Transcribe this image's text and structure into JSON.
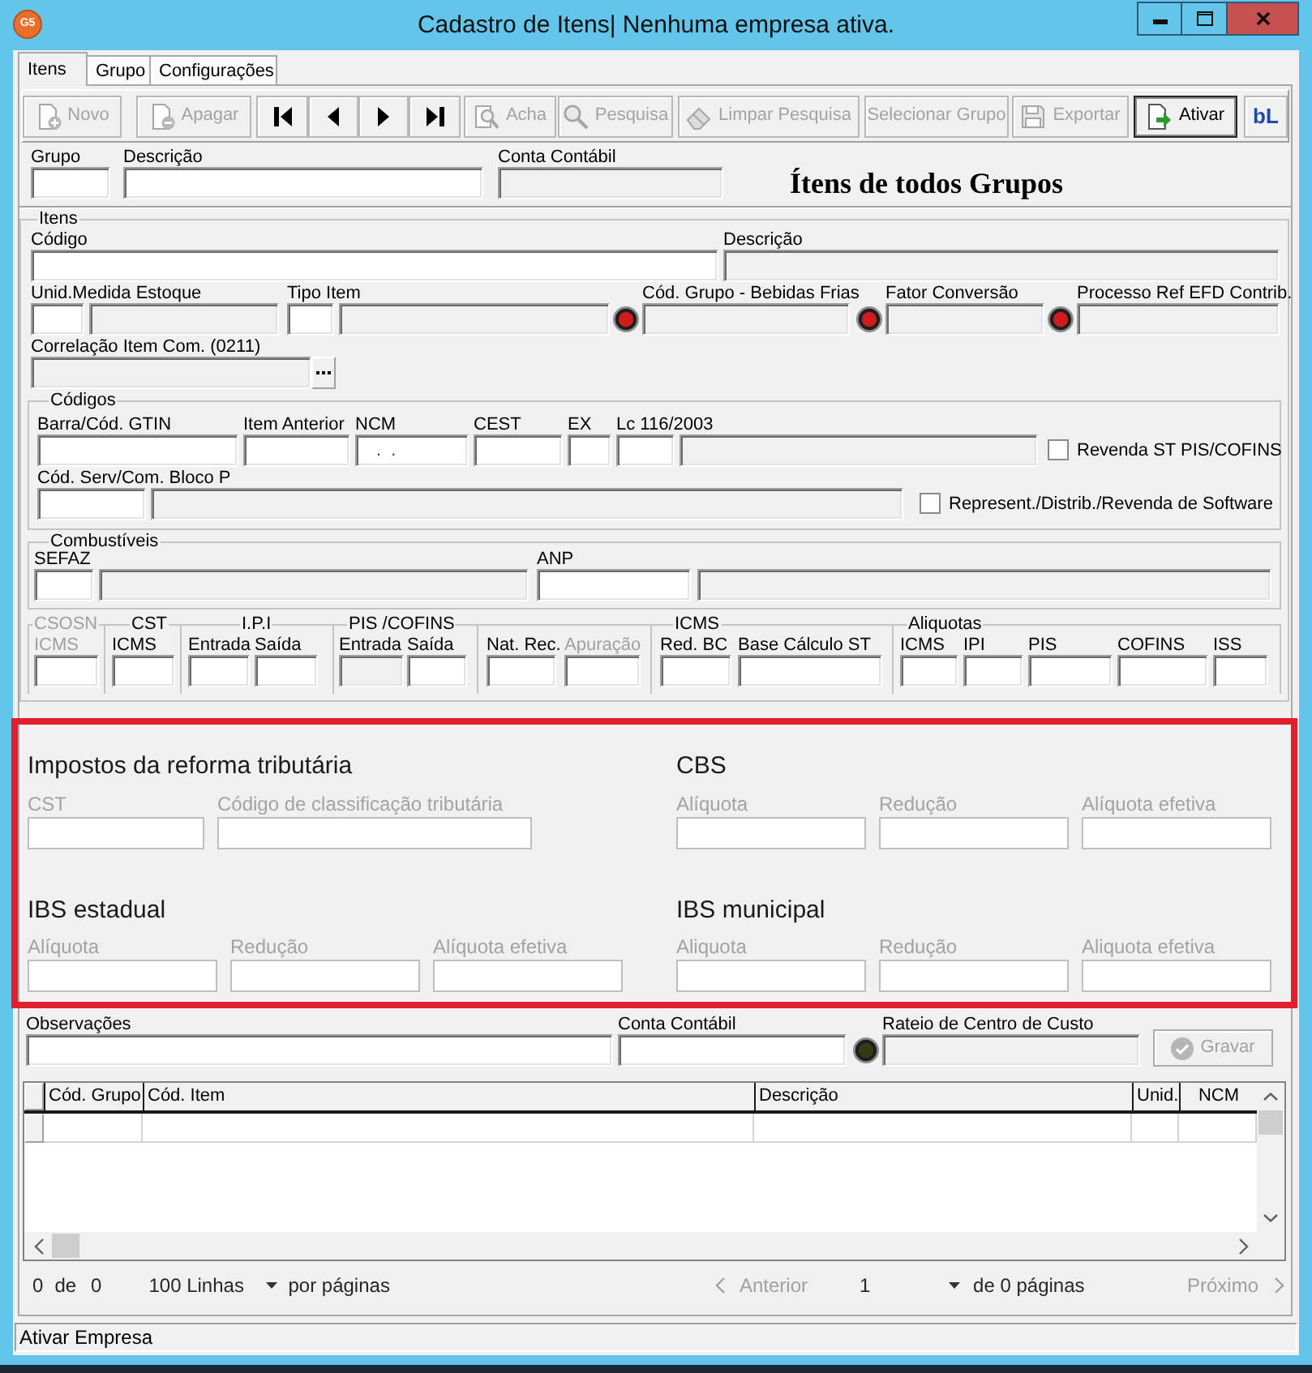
{
  "window": {
    "logo": "G5",
    "title": "Cadastro de Itens| Nenhuma empresa ativa."
  },
  "tabs": [
    {
      "label": "Itens",
      "selected": true
    },
    {
      "label": "Grupo",
      "selected": false
    },
    {
      "label": "Configurações",
      "selected": false
    }
  ],
  "toolbar": [
    {
      "kind": "new",
      "label": "Novo",
      "disabled": true,
      "focused": false
    },
    {
      "kind": "delete",
      "label": "Apagar",
      "disabled": true,
      "focused": false
    },
    {
      "kind": "first",
      "disabled": false,
      "focused": false
    },
    {
      "kind": "previous",
      "disabled": false,
      "focused": false
    },
    {
      "kind": "next",
      "disabled": false,
      "focused": false
    },
    {
      "kind": "last",
      "disabled": false,
      "focused": false
    },
    {
      "kind": "find",
      "label": "Acha",
      "disabled": true,
      "focused": false
    },
    {
      "kind": "search",
      "label": "Pesquisa",
      "disabled": true,
      "focused": false
    },
    {
      "kind": "clear",
      "label": "Limpar Pesquisa",
      "disabled": true,
      "focused": false
    },
    {
      "kind": "plain",
      "label": "Selecionar Grupo",
      "disabled": true,
      "focused": false
    },
    {
      "kind": "export",
      "label": "Exportar",
      "disabled": true,
      "focused": false
    },
    {
      "kind": "activate",
      "label": "Ativar",
      "disabled": false,
      "focused": true
    },
    {
      "kind": "logo",
      "label": "bL",
      "disabled": false,
      "focused": false
    }
  ],
  "filter": {
    "fields": [
      {
        "label": "Grupo",
        "disabled": false
      },
      {
        "label": "Descrição",
        "disabled": false
      },
      {
        "label": "Conta Contábil",
        "disabled": true
      }
    ],
    "heading": "Ítens de todos Grupos"
  },
  "itens": {
    "title": "Itens",
    "rows": [
      {
        "fields": [
          {
            "kind": "plain",
            "label": "Código",
            "boxes": [
              {
                "disabled": false
              }
            ]
          },
          {
            "kind": "plain",
            "label": "Descrição",
            "boxes": [
              {
                "disabled": true
              }
            ]
          }
        ]
      },
      {
        "fields": [
          {
            "kind": "plain",
            "label": "Unid.Medida Estoque",
            "boxes": [
              {
                "disabled": false
              },
              {
                "disabled": true
              }
            ]
          },
          {
            "kind": "plain",
            "label": "Tipo Item",
            "boxes": [
              {
                "disabled": false
              },
              {
                "disabled": true
              }
            ]
          },
          {
            "kind": "lookup",
            "color": "#d01c1c",
            "label": "Cód. Grupo - Bebidas Frias",
            "boxes": [
              {
                "disabled": true
              }
            ]
          },
          {
            "kind": "lookup",
            "color": "#d01c1c",
            "label": "Fator Conversão",
            "boxes": [
              {
                "disabled": true
              }
            ]
          },
          {
            "kind": "lookup",
            "color": "#d01c1c",
            "label": "Processo Ref EFD Contrib.",
            "boxes": [
              {
                "disabled": true
              }
            ]
          }
        ]
      },
      {
        "fields": [
          {
            "kind": "browse",
            "label": "Correlação Item Com. (0211)",
            "boxes": [
              {
                "disabled": true
              }
            ]
          }
        ]
      }
    ],
    "codigos": {
      "title": "Códigos",
      "rows": [
        {
          "fields": [
            {
              "label": "Barra/Cód. GTIN",
              "boxes": [
                {
                  "disabled": false
                }
              ]
            },
            {
              "label": "Item Anterior",
              "boxes": [
                {
                  "disabled": false
                }
              ]
            },
            {
              "label": "NCM",
              "boxes": [
                {
                  "disabled": false,
                  "value": ".  ."
                }
              ]
            },
            {
              "label": "CEST",
              "boxes": [
                {
                  "disabled": false
                }
              ]
            },
            {
              "label": "EX",
              "boxes": [
                {
                  "disabled": false
                }
              ]
            },
            {
              "label": "Lc 116/2003",
              "boxes": [
                {
                  "disabled": false
                },
                {
                  "disabled": true
                }
              ]
            }
          ],
          "checkbox": {
            "label": "Revenda ST PIS/COFINS",
            "checked": false
          }
        },
        {
          "fields": [
            {
              "label": "Cód. Serv/Com. Bloco P",
              "boxes": [
                {
                  "disabled": false
                },
                {
                  "disabled": true
                }
              ]
            }
          ],
          "checkbox": {
            "label": "Represent./Distrib./Revenda de Software",
            "checked": false
          }
        }
      ]
    },
    "combustiveis": {
      "title": "Combustíveis",
      "fields": [
        {
          "label": "SEFAZ",
          "boxes": [
            {
              "disabled": false
            },
            {
              "disabled": true
            }
          ]
        },
        {
          "label": "ANP",
          "boxes": [
            {
              "disabled": false
            },
            {
              "disabled": true
            }
          ]
        }
      ]
    },
    "tributos": [
      {
        "title": "CSOSN",
        "dimmed": true,
        "fields": [
          {
            "label": "ICMS",
            "dimmed": true,
            "disabled": false
          }
        ]
      },
      {
        "title": "CST",
        "dimmed": false,
        "fields": [
          {
            "label": "ICMS",
            "dimmed": false,
            "disabled": false
          }
        ]
      },
      {
        "title": "I.P.I",
        "dimmed": false,
        "fields": [
          {
            "label": "Entrada",
            "dimmed": false,
            "disabled": false
          },
          {
            "label": "Saída",
            "dimmed": false,
            "disabled": false
          }
        ]
      },
      {
        "title": "PIS /COFINS",
        "dimmed": false,
        "fields": [
          {
            "label": "Entrada",
            "dimmed": false,
            "disabled": true
          },
          {
            "label": "Saída",
            "dimmed": false,
            "disabled": false
          }
        ]
      },
      {
        "fields": [
          {
            "label": "Nat. Rec.",
            "dimmed": false,
            "disabled": false
          },
          {
            "label": "Apuração",
            "dimmed": true,
            "disabled": false
          }
        ]
      },
      {
        "title": "ICMS",
        "dimmed": false,
        "fields": [
          {
            "label": "Red. BC",
            "dimmed": false,
            "disabled": false
          },
          {
            "label": "Base Cálculo ST",
            "dimmed": false,
            "disabled": false
          }
        ]
      },
      {
        "title": "Aliquotas",
        "dimmed": false,
        "fields": [
          {
            "label": "ICMS",
            "dimmed": false,
            "disabled": false
          },
          {
            "label": "IPI",
            "dimmed": false,
            "disabled": false
          },
          {
            "label": "PIS",
            "dimmed": false,
            "disabled": false
          },
          {
            "label": "COFINS",
            "dimmed": false,
            "disabled": false
          },
          {
            "label": "ISS",
            "dimmed": false,
            "disabled": false
          }
        ]
      }
    ]
  },
  "reforma": [
    {
      "title": "Impostos da reforma tributária",
      "fields": [
        {
          "label": "CST"
        },
        {
          "label": "Código de classificação tributária"
        }
      ]
    },
    {
      "title": "CBS",
      "fields": [
        {
          "label": "Alíquota"
        },
        {
          "label": "Redução"
        },
        {
          "label": "Alíquota efetiva"
        }
      ]
    },
    {
      "title": "IBS estadual",
      "fields": [
        {
          "label": "Alíquota"
        },
        {
          "label": "Redução"
        },
        {
          "label": "Alíquota efetiva"
        }
      ]
    },
    {
      "title": "IBS municipal",
      "fields": [
        {
          "label": "Aliquota"
        },
        {
          "label": "Redução"
        },
        {
          "label": "Aliquota efetiva"
        }
      ]
    }
  ],
  "footer": {
    "fields": [
      {
        "kind": "plain",
        "label": "Observações",
        "boxes": [
          {
            "disabled": false
          }
        ]
      },
      {
        "kind": "plain",
        "label": "Conta Contábil",
        "boxes": [
          {
            "disabled": false
          }
        ]
      },
      {
        "kind": "lookup",
        "color": "#363a14",
        "label": "Rateio de Centro de Custo",
        "boxes": [
          {
            "disabled": true
          }
        ]
      }
    ],
    "save": {
      "label": "Gravar",
      "disabled": true
    }
  },
  "table": {
    "columns": [
      "Cód. Grupo",
      "Cód. Item",
      "Descrição",
      "Unid.",
      "NCM"
    ],
    "rows": [
      {
        "selected": false
      }
    ]
  },
  "pager": {
    "record": "0",
    "of": "de",
    "total": "0",
    "page_size": "100 Linhas",
    "per_page": "por páginas",
    "previous": {
      "label": "Anterior",
      "disabled": true
    },
    "page": "1",
    "pages": "de 0 páginas",
    "next": {
      "label": "Próximo",
      "disabled": true
    }
  },
  "status_bar": "Ativar Empresa"
}
